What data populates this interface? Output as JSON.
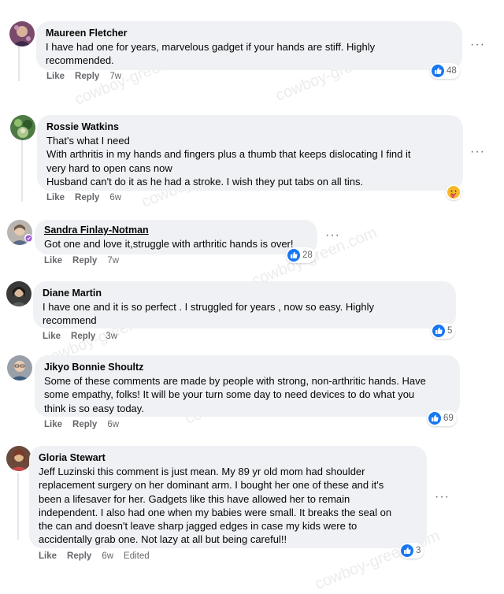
{
  "comments": [
    {
      "author": "Maureen Fletcher",
      "text": "I have had one for years, marvelous gadget if your hands are stiff. Highly\nrecommended.",
      "like": "Like",
      "reply": "Reply",
      "time": "7w",
      "reaction_count": "48"
    },
    {
      "author": "Rossie Watkins",
      "text": "That's what I need\nWith arthritis in my hands and fingers plus a thumb that keeps dislocating I find it\nvery hard to open cans now\nHusband can't do it as he had a stroke. I wish they put tabs on all tins.",
      "like": "Like",
      "reply": "Reply",
      "time": "6w"
    },
    {
      "author": "Sandra Finlay-Notman",
      "text": "Got one and love it,struggle with arthritic hands is over!",
      "like": "Like",
      "reply": "Reply",
      "time": "7w",
      "reaction_count": "28"
    },
    {
      "author": "Diane Martin",
      "text": "I have one and it is so perfect . I struggled for years , now so easy. Highly\nrecommend",
      "like": "Like",
      "reply": "Reply",
      "time": "3w",
      "reaction_count": "5"
    },
    {
      "author": "Jikyo Bonnie Shoultz",
      "text": "Some of these comments are made by people with strong, non-arthritic hands. Have\nsome empathy, folks! It will be your turn some day to need devices to do what you\nthink is so easy today.",
      "like": "Like",
      "reply": "Reply",
      "time": "6w",
      "reaction_count": "69"
    },
    {
      "author": "Gloria Stewart",
      "text": "Jeff Luzinski this comment is just mean. My 89 yr old mom had shoulder\nreplacement surgery on her dominant arm. I bought her one of these and it's\nbeen a lifesaver for her. Gadgets like this have allowed her to remain\nindependent. I also had one when my babies were small. It breaks the seal on\nthe can and doesn't leave sharp jagged edges in case my kids were to\naccidentally grab one. Not lazy at all but being careful!!",
      "like": "Like",
      "reply": "Reply",
      "time": "6w",
      "edited": "Edited",
      "reaction_count": "3"
    }
  ],
  "more_options": "···",
  "watermark": "cowboy-green.com",
  "colors": {
    "bubble": "#eff1f4",
    "meta_text": "#65676b",
    "like_blue": "#1877f2"
  }
}
